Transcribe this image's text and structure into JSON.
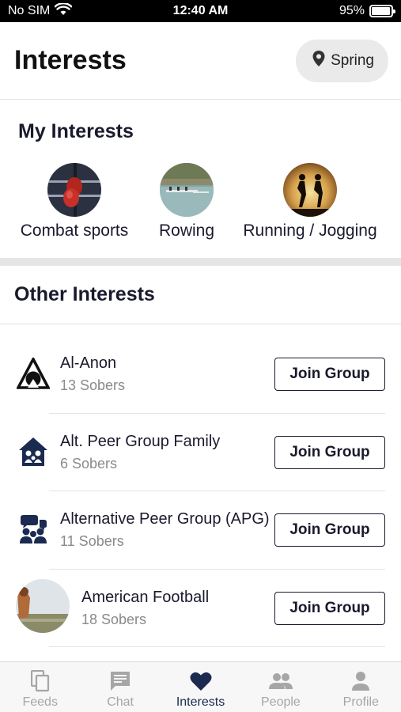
{
  "status_bar": {
    "carrier": "No SIM",
    "time": "12:40 AM",
    "battery": "95%",
    "battery_level": 0.95
  },
  "header": {
    "title": "Interests",
    "location": "Spring"
  },
  "my_interests": {
    "title": "My Interests",
    "items": [
      {
        "label": "Combat sports",
        "icon": "boxing-gloves-photo"
      },
      {
        "label": "Rowing",
        "icon": "rowing-photo"
      },
      {
        "label": "Running / Jogging",
        "icon": "runners-silhouette-photo"
      }
    ]
  },
  "other_interests": {
    "title": "Other Interests",
    "join_label": "Join Group",
    "groups": [
      {
        "name": "Al-Anon",
        "count": "13 Sobers",
        "icon": "al-anon-triangle-icon"
      },
      {
        "name": "Alt. Peer Group Family",
        "count": "6 Sobers",
        "icon": "family-house-icon"
      },
      {
        "name": "Alternative Peer Group (APG)",
        "count": "11 Sobers",
        "icon": "peer-group-icon"
      },
      {
        "name": "American Football",
        "count": "18 Sobers",
        "icon": "football-photo"
      }
    ]
  },
  "tabs": [
    {
      "label": "Feeds",
      "icon": "feeds-icon",
      "active": false
    },
    {
      "label": "Chat",
      "icon": "chat-icon",
      "active": false
    },
    {
      "label": "Interests",
      "icon": "heart-icon",
      "active": true
    },
    {
      "label": "People",
      "icon": "people-icon",
      "active": false
    },
    {
      "label": "Profile",
      "icon": "profile-icon",
      "active": false
    }
  ],
  "colors": {
    "primary": "#1a2a50",
    "inactive_tab": "#a6a6a6",
    "pill_bg": "#eaeaea",
    "secondary_text": "#8a8a8a"
  }
}
